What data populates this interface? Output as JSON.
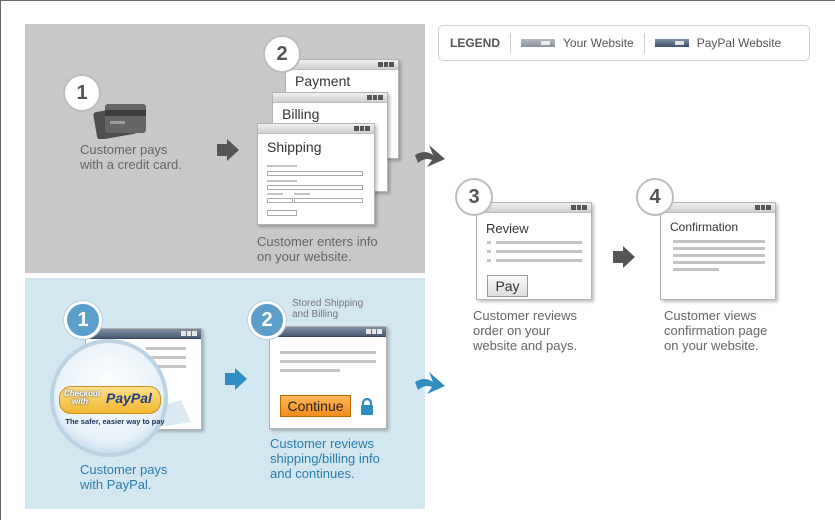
{
  "legend": {
    "label": "LEGEND",
    "your_website": "Your Website",
    "paypal_website": "PayPal Website"
  },
  "colors": {
    "your_website": "#9aa1aa",
    "paypal_website": "#566882",
    "top_panel": "#c8c8c8",
    "bottom_panel": "#d3e7f1",
    "step_blue": "#5d9fcb",
    "continue_button": "#f38d1b",
    "caption_blue": "#2a7cac"
  },
  "top_flow": {
    "step1": {
      "number": "1",
      "caption_line1": "Customer pays",
      "caption_line2": "with a credit card.",
      "icon": "credit-card-icon"
    },
    "step2": {
      "number": "2",
      "window_payment": "Payment",
      "window_billing": "Billing",
      "window_shipping": "Shipping",
      "caption_line1": "Customer enters info",
      "caption_line2": "on your website."
    }
  },
  "bottom_flow": {
    "step1": {
      "number": "1",
      "badge_line1": "Checkout",
      "badge_line2": "with",
      "badge_brand": "PayPal",
      "badge_tagline": "The safer, easier way to pay",
      "caption_line1": "Customer pays",
      "caption_line2": "with PayPal."
    },
    "step2": {
      "number": "2",
      "header_line1": "Stored Shipping",
      "header_line2": "and Billing",
      "button": "Continue",
      "icon": "lock-icon",
      "caption_line1": "Customer reviews",
      "caption_line2": "shipping/billing info",
      "caption_line3": "and continues."
    }
  },
  "shared_flow": {
    "step3": {
      "number": "3",
      "window_title": "Review",
      "button": "Pay",
      "caption_line1": "Customer reviews",
      "caption_line2": "order on your",
      "caption_line3": "website and pays."
    },
    "step4": {
      "number": "4",
      "window_title": "Confirmation",
      "caption_line1": "Customer views",
      "caption_line2": "confirmation page",
      "caption_line3": "on your website."
    }
  }
}
